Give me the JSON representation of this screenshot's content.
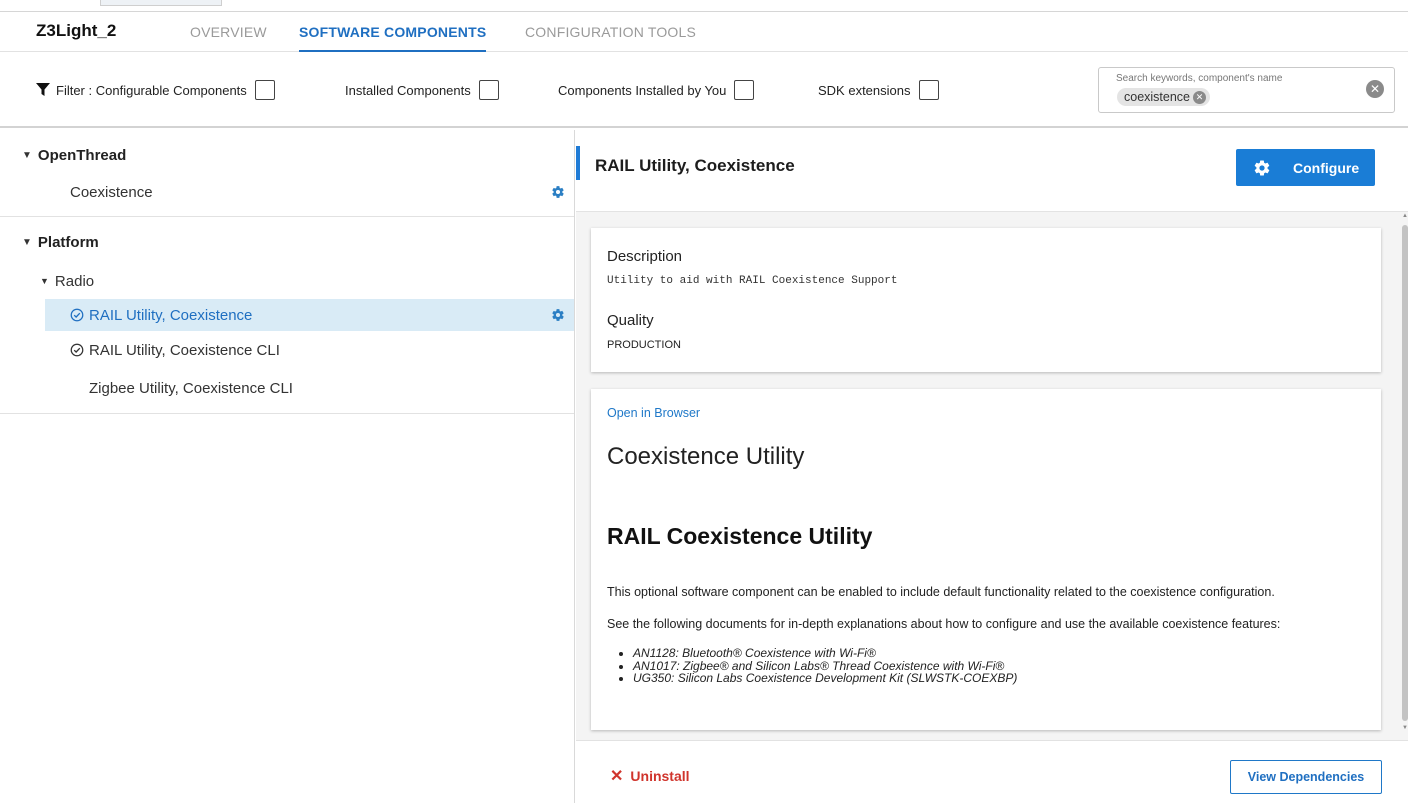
{
  "header": {
    "project_name": "Z3Light_2",
    "tabs": [
      {
        "label": "OVERVIEW",
        "active": false
      },
      {
        "label": "SOFTWARE COMPONENTS",
        "active": true
      },
      {
        "label": "CONFIGURATION TOOLS",
        "active": false
      }
    ]
  },
  "filters": {
    "prefix": "Filter :",
    "items": [
      {
        "label": "Configurable Components",
        "checked": false
      },
      {
        "label": "Installed Components",
        "checked": false
      },
      {
        "label": "Components Installed by You",
        "checked": false
      },
      {
        "label": "SDK extensions",
        "checked": false
      }
    ],
    "search": {
      "placeholder": "Search keywords, component's name",
      "chip": "coexistence"
    }
  },
  "tree": {
    "groups": [
      {
        "label": "OpenThread",
        "items": [
          {
            "label": "Coexistence",
            "configurable": true
          }
        ]
      },
      {
        "label": "Platform",
        "subgroup": "Radio",
        "items": [
          {
            "label": "RAIL Utility, Coexistence",
            "installed": true,
            "selected": true,
            "configurable": true
          },
          {
            "label": "RAIL Utility, Coexistence CLI",
            "installed": true,
            "selected": false
          },
          {
            "label": "Zigbee Utility, Coexistence CLI",
            "installed": false,
            "selected": false
          }
        ]
      }
    ]
  },
  "detail": {
    "title": "RAIL Utility, Coexistence",
    "configure_label": "Configure",
    "description_label": "Description",
    "description": "Utility to aid with RAIL Coexistence Support",
    "quality_label": "Quality",
    "quality": "PRODUCTION",
    "open_in_browser": "Open in Browser",
    "doc_title": "Coexistence Utility",
    "doc_heading": "RAIL Coexistence Utility",
    "para1": "This optional software component can be enabled to include default functionality related to the coexistence configuration.",
    "para2": "See the following documents for in-depth explanations about how to configure and use the available coexistence features:",
    "docs": [
      "AN1128: Bluetooth® Coexistence with Wi-Fi®",
      "AN1017: Zigbee® and Silicon Labs® Thread Coexistence with Wi-Fi®",
      "UG350: Silicon Labs Coexistence Development Kit (SLWSTK-COEXBP)"
    ],
    "uninstall_label": "Uninstall",
    "view_dependencies_label": "View Dependencies"
  },
  "colors": {
    "accent": "#1a7dd6",
    "selected_row": "#d9ebf6",
    "danger": "#d0342c"
  }
}
